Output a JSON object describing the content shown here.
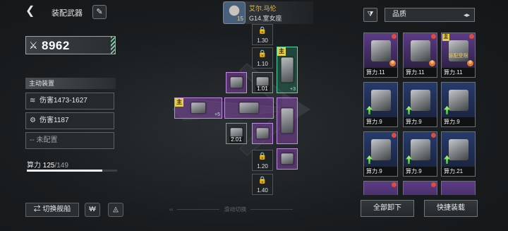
{
  "header": {
    "back_icon": "chevron-left-icon",
    "title": "装配武器",
    "rename_icon": "pen-icon"
  },
  "pilot": {
    "name": "艾尔.马伦",
    "subtitle": "G14.室女座",
    "level": "15"
  },
  "power": {
    "icon": "crossed-swords-icon",
    "value": "8962"
  },
  "active_section": {
    "title": "主动装置",
    "items": [
      {
        "icon": "triple-slash-icon",
        "label": "伤害1473-1627"
      },
      {
        "icon": "gear-ring-icon",
        "label": "伤害1187"
      },
      {
        "icon": "dash-icon",
        "label": "-- 未配置"
      }
    ]
  },
  "capacity": {
    "label": "算力",
    "current": "125",
    "max": "/149",
    "fill_fraction": 0.839
  },
  "bottom_left": {
    "switch_ship": "⇄ 切换舰船",
    "btn2_icon": "ship-emblem-icon",
    "btn3_icon": "triangle-arrows-icon"
  },
  "slide_hint": "滑动切换",
  "slots": [
    {
      "label": "1.30",
      "locked": true
    },
    {
      "label": "1.10",
      "locked": true
    },
    {
      "label": "1.20",
      "locked": true
    },
    {
      "label": "1.40",
      "locked": true
    }
  ],
  "tiles": [
    {
      "tag": "主",
      "plus": "+3",
      "teal": true
    },
    {
      "tag": "",
      "level": "1.01"
    },
    {
      "tag": "主",
      "plus": "+5"
    },
    {
      "tag": "",
      "level": "2.01"
    }
  ],
  "right": {
    "filter_icon": "filter-icon",
    "sort_label": "品质",
    "sort_icon": "sort-toggle-icon"
  },
  "cards": [
    {
      "stat": "算力.11",
      "style": "purple",
      "dot": true
    },
    {
      "stat": "算力.11",
      "style": "purple",
      "dot": true
    },
    {
      "stat": "算力.11",
      "style": "purple",
      "dot": true,
      "tag": "主",
      "warn": "装配受限"
    },
    {
      "stat": "算力.9",
      "style": "blue",
      "dot": false
    },
    {
      "stat": "算力.9",
      "style": "blue",
      "dot": false
    },
    {
      "stat": "算力.9",
      "style": "blue",
      "dot": false
    },
    {
      "stat": "算力.9",
      "style": "blue",
      "dot": true
    },
    {
      "stat": "算力.9",
      "style": "blue",
      "dot": true
    },
    {
      "stat": "算力.21",
      "style": "blue",
      "dot": false
    }
  ],
  "actions": {
    "unequip_all": "全部卸下",
    "quick_equip": "快捷装载"
  }
}
